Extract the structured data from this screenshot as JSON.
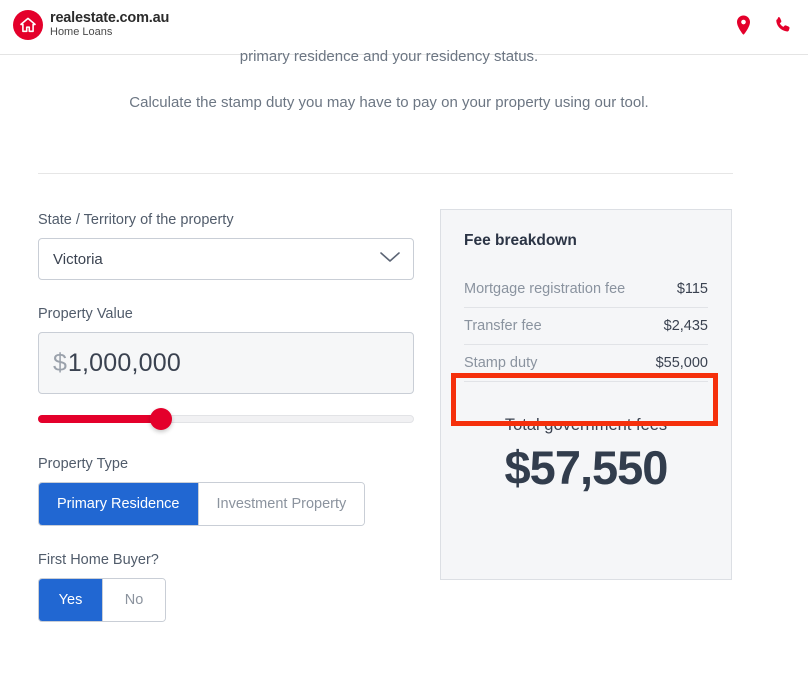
{
  "header": {
    "brand_line1": "realestate.com.au",
    "brand_line2": "Home Loans",
    "logo_icon": "house-logo-icon",
    "brand_color": "#e4002b",
    "actions": [
      {
        "name": "location-pin-icon",
        "label": ""
      },
      {
        "name": "phone-icon",
        "label": ""
      }
    ]
  },
  "intro": {
    "line1": "primary residence and your residency status.",
    "line2": "Calculate the stamp duty you may have to pay on your property using our tool."
  },
  "form": {
    "state_field": {
      "label": "State / Territory of the property",
      "value": "Victoria",
      "chevron_icon": "chevron-down-icon"
    },
    "property_value_field": {
      "label": "Property Value",
      "prefix": "$",
      "value": "1,000,000",
      "placeholder": "0"
    },
    "slider": {
      "fill_percent": 34,
      "accent_color": "#e4002b"
    },
    "property_type": {
      "label": "Property Type",
      "options": [
        "Primary Residence",
        "Investment Property"
      ],
      "selected": "Primary Residence"
    },
    "first_home_buyer": {
      "label": "First Home Buyer?",
      "options": [
        "Yes",
        "No"
      ],
      "selected": "Yes"
    },
    "selected_color": "#2167d2"
  },
  "fee_breakdown": {
    "title": "Fee breakdown",
    "rows": [
      {
        "label": "Mortgage registration fee",
        "value": "$115"
      },
      {
        "label": "Transfer fee",
        "value": "$2,435"
      },
      {
        "label": "Stamp duty",
        "value": "$55,000"
      }
    ],
    "total_label": "Total government fees",
    "total_value": "$57,550",
    "highlight_color": "#f5300c",
    "highlighted_row": "Stamp duty"
  }
}
